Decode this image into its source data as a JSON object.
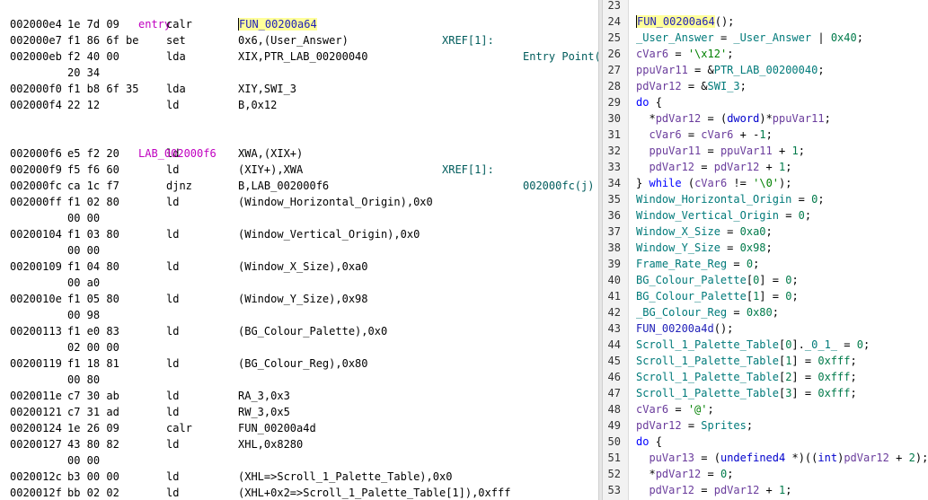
{
  "listing": {
    "entry_label": "entry",
    "entry_xref": "XREF[1]:",
    "entry_xref_from": "Entry Point(",
    "label2": "LAB_002000f6",
    "label2_xref": "XREF[1]:",
    "label2_xref_from": "002000fc(j)",
    "rows": [
      {
        "addr": "002000e4",
        "bytes": "1e 7d 09",
        "mnem": "calr",
        "ops": [
          [
            "FUN_00200a64",
            "fn hl cursor-mark"
          ]
        ]
      },
      {
        "addr": "002000e7",
        "bytes": "f1 86 6f be",
        "mnem": "set",
        "ops": [
          [
            "0x6,(User_Answer)",
            "plain"
          ]
        ]
      },
      {
        "addr": "002000eb",
        "bytes": "f2 40 00",
        "mnem": "lda",
        "ops": [
          [
            "XIX,PTR_LAB_00200040",
            "plain"
          ]
        ]
      },
      {
        "addr": "",
        "bytes": "20 34",
        "mnem": "",
        "ops": []
      },
      {
        "addr": "002000f0",
        "bytes": "f1 b8 6f 35",
        "mnem": "lda",
        "ops": [
          [
            "XIY,SWI_3",
            "plain"
          ]
        ]
      },
      {
        "addr": "002000f4",
        "bytes": "22 12",
        "mnem": "ld",
        "ops": [
          [
            "B,0x12",
            "plain"
          ]
        ]
      },
      {
        "addr": "002000f6",
        "bytes": "e5 f2 20",
        "mnem": "ld",
        "ops": [
          [
            "XWA,(XIX+)",
            "plain"
          ]
        ]
      },
      {
        "addr": "002000f9",
        "bytes": "f5 f6 60",
        "mnem": "ld",
        "ops": [
          [
            "(XIY+),XWA",
            "plain"
          ]
        ]
      },
      {
        "addr": "002000fc",
        "bytes": "ca 1c f7",
        "mnem": "djnz",
        "ops": [
          [
            "B,LAB_002000f6",
            "plain"
          ]
        ]
      },
      {
        "addr": "002000ff",
        "bytes": "f1 02 80",
        "mnem": "ld",
        "ops": [
          [
            "(Window_Horizontal_Origin),0x0",
            "plain"
          ]
        ]
      },
      {
        "addr": "",
        "bytes": "00 00",
        "mnem": "",
        "ops": []
      },
      {
        "addr": "00200104",
        "bytes": "f1 03 80",
        "mnem": "ld",
        "ops": [
          [
            "(Window_Vertical_Origin),0x0",
            "plain"
          ]
        ]
      },
      {
        "addr": "",
        "bytes": "00 00",
        "mnem": "",
        "ops": []
      },
      {
        "addr": "00200109",
        "bytes": "f1 04 80",
        "mnem": "ld",
        "ops": [
          [
            "(Window_X_Size),0xa0",
            "plain"
          ]
        ]
      },
      {
        "addr": "",
        "bytes": "00 a0",
        "mnem": "",
        "ops": []
      },
      {
        "addr": "0020010e",
        "bytes": "f1 05 80",
        "mnem": "ld",
        "ops": [
          [
            "(Window_Y_Size),0x98",
            "plain"
          ]
        ]
      },
      {
        "addr": "",
        "bytes": "00 98",
        "mnem": "",
        "ops": []
      },
      {
        "addr": "00200113",
        "bytes": "f1 e0 83",
        "mnem": "ld",
        "ops": [
          [
            "(BG_Colour_Palette),0x0",
            "plain"
          ]
        ]
      },
      {
        "addr": "",
        "bytes": "02 00 00",
        "mnem": "",
        "ops": []
      },
      {
        "addr": "00200119",
        "bytes": "f1 18 81",
        "mnem": "ld",
        "ops": [
          [
            "(BG_Colour_Reg),0x80",
            "plain"
          ]
        ]
      },
      {
        "addr": "",
        "bytes": "00 80",
        "mnem": "",
        "ops": []
      },
      {
        "addr": "0020011e",
        "bytes": "c7 30 ab",
        "mnem": "ld",
        "ops": [
          [
            "RA_3,0x3",
            "plain"
          ]
        ]
      },
      {
        "addr": "00200121",
        "bytes": "c7 31 ad",
        "mnem": "ld",
        "ops": [
          [
            "RW_3,0x5",
            "plain"
          ]
        ]
      },
      {
        "addr": "00200124",
        "bytes": "1e 26 09",
        "mnem": "calr",
        "ops": [
          [
            "FUN_00200a4d",
            "plain"
          ]
        ]
      },
      {
        "addr": "00200127",
        "bytes": "43 80 82",
        "mnem": "ld",
        "ops": [
          [
            "XHL,0x8280",
            "plain"
          ]
        ]
      },
      {
        "addr": "",
        "bytes": "00 00",
        "mnem": "",
        "ops": []
      },
      {
        "addr": "0020012c",
        "bytes": "b3 00 00",
        "mnem": "ld",
        "ops": [
          [
            "(XHL=>Scroll_1_Palette_Table),0x0",
            "plain"
          ]
        ]
      },
      {
        "addr": "0020012f",
        "bytes": "bb 02 02",
        "mnem": "ld",
        "ops": [
          [
            "(XHL+0x2=>Scroll_1_Palette_Table[1]),0xfff",
            "plain"
          ]
        ]
      }
    ]
  },
  "decompiler": {
    "lines": [
      {
        "n": "23",
        "t": ""
      },
      {
        "n": "24",
        "t": "FUN_00200a64();"
      },
      {
        "n": "25",
        "t": "_User_Answer = _User_Answer | 0x40;"
      },
      {
        "n": "26",
        "t": "cVar6 = '\\x12';"
      },
      {
        "n": "27",
        "t": "ppuVar11 = &PTR_LAB_00200040;"
      },
      {
        "n": "28",
        "t": "pdVar12 = &SWI_3;"
      },
      {
        "n": "29",
        "t": "do {"
      },
      {
        "n": "30",
        "t": "  *pdVar12 = (dword)*ppuVar11;"
      },
      {
        "n": "31",
        "t": "  cVar6 = cVar6 + -1;"
      },
      {
        "n": "32",
        "t": "  ppuVar11 = ppuVar11 + 1;"
      },
      {
        "n": "33",
        "t": "  pdVar12 = pdVar12 + 1;"
      },
      {
        "n": "34",
        "t": "} while (cVar6 != '\\0');"
      },
      {
        "n": "35",
        "t": "Window_Horizontal_Origin = 0;"
      },
      {
        "n": "36",
        "t": "Window_Vertical_Origin = 0;"
      },
      {
        "n": "37",
        "t": "Window_X_Size = 0xa0;"
      },
      {
        "n": "38",
        "t": "Window_Y_Size = 0x98;"
      },
      {
        "n": "39",
        "t": "Frame_Rate_Reg = 0;"
      },
      {
        "n": "40",
        "t": "BG_Colour_Palette[0] = 0;"
      },
      {
        "n": "41",
        "t": "BG_Colour_Palette[1] = 0;"
      },
      {
        "n": "42",
        "t": "_BG_Colour_Reg = 0x80;"
      },
      {
        "n": "43",
        "t": "FUN_00200a4d();"
      },
      {
        "n": "44",
        "t": "Scroll_1_Palette_Table[0]._0_1_ = 0;"
      },
      {
        "n": "45",
        "t": "Scroll_1_Palette_Table[1] = 0xfff;"
      },
      {
        "n": "46",
        "t": "Scroll_1_Palette_Table[2] = 0xfff;"
      },
      {
        "n": "47",
        "t": "Scroll_1_Palette_Table[3] = 0xfff;"
      },
      {
        "n": "48",
        "t": "cVar6 = '@';"
      },
      {
        "n": "49",
        "t": "pdVar12 = Sprites;"
      },
      {
        "n": "50",
        "t": "do {"
      },
      {
        "n": "51",
        "t": "  puVar13 = (undefined4 *)((int)pdVar12 + 2);"
      },
      {
        "n": "52",
        "t": "  *pdVar12 = 0;"
      },
      {
        "n": "53",
        "t": "  pdVar12 = pdVar12 + 1;"
      }
    ]
  },
  "colors": {
    "label": "#c000c0",
    "xref": "#005c5c",
    "function": "#1f1fb8",
    "global": "#007a7a",
    "local": "#6a3c9c",
    "keyword": "#0000ff",
    "number": "#007a4a",
    "highlight": "#ffff99"
  }
}
